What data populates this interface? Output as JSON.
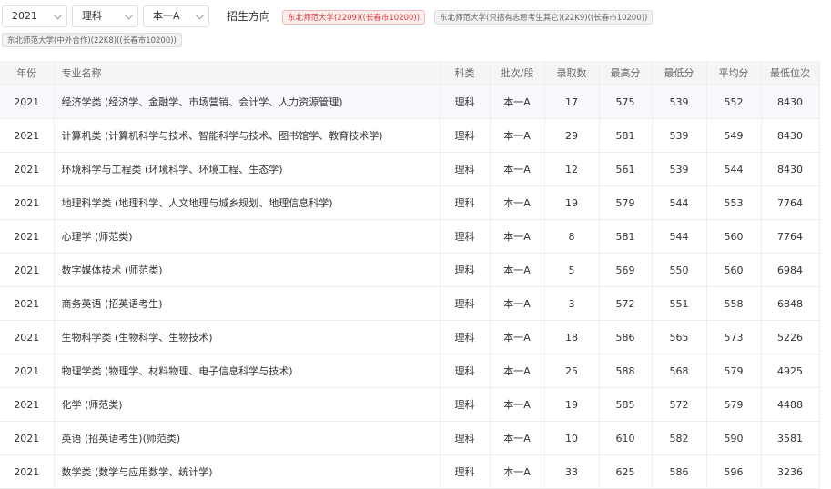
{
  "filters": {
    "year": "2021",
    "subject": "理科",
    "batch": "本一A",
    "direction_label": "招生方向",
    "tags": [
      "东北师范大学(2209)((长春市10200))",
      "东北师范大学(只招有志愿考生其它)(22K9)((长春市10200))",
      "东北师范大学(中外合作)(22K8)((长春市10200))"
    ]
  },
  "table": {
    "headers": [
      "年份",
      "专业名称",
      "科类",
      "批次/段",
      "录取数",
      "最高分",
      "最低分",
      "平均分",
      "最低位次"
    ],
    "rows": [
      [
        "2021",
        "经济学类 (经济学、金融学、市场营销、会计学、人力资源管理)",
        "理科",
        "本一A",
        "17",
        "575",
        "539",
        "552",
        "8430"
      ],
      [
        "2021",
        "计算机类 (计算机科学与技术、智能科学与技术、图书馆学、教育技术学)",
        "理科",
        "本一A",
        "29",
        "581",
        "539",
        "549",
        "8430"
      ],
      [
        "2021",
        "环境科学与工程类 (环境科学、环境工程、生态学)",
        "理科",
        "本一A",
        "12",
        "561",
        "539",
        "544",
        "8430"
      ],
      [
        "2021",
        "地理科学类 (地理科学、人文地理与城乡规划、地理信息科学)",
        "理科",
        "本一A",
        "19",
        "579",
        "544",
        "553",
        "7764"
      ],
      [
        "2021",
        "心理学 (师范类)",
        "理科",
        "本一A",
        "8",
        "581",
        "544",
        "560",
        "7764"
      ],
      [
        "2021",
        "数字媒体技术 (师范类)",
        "理科",
        "本一A",
        "5",
        "569",
        "550",
        "560",
        "6984"
      ],
      [
        "2021",
        "商务英语 (招英语考生)",
        "理科",
        "本一A",
        "3",
        "572",
        "551",
        "558",
        "6848"
      ],
      [
        "2021",
        "生物科学类 (生物科学、生物技术)",
        "理科",
        "本一A",
        "18",
        "586",
        "565",
        "573",
        "5226"
      ],
      [
        "2021",
        "物理学类 (物理学、材料物理、电子信息科学与技术)",
        "理科",
        "本一A",
        "25",
        "588",
        "568",
        "579",
        "4925"
      ],
      [
        "2021",
        "化学 (师范类)",
        "理科",
        "本一A",
        "19",
        "585",
        "572",
        "579",
        "4488"
      ],
      [
        "2021",
        "英语 (招英语考生)(师范类)",
        "理科",
        "本一A",
        "10",
        "610",
        "582",
        "590",
        "3581"
      ],
      [
        "2021",
        "数学类 (数学与应用数学、统计学)",
        "理科",
        "本一A",
        "33",
        "625",
        "586",
        "596",
        "3236"
      ]
    ]
  }
}
